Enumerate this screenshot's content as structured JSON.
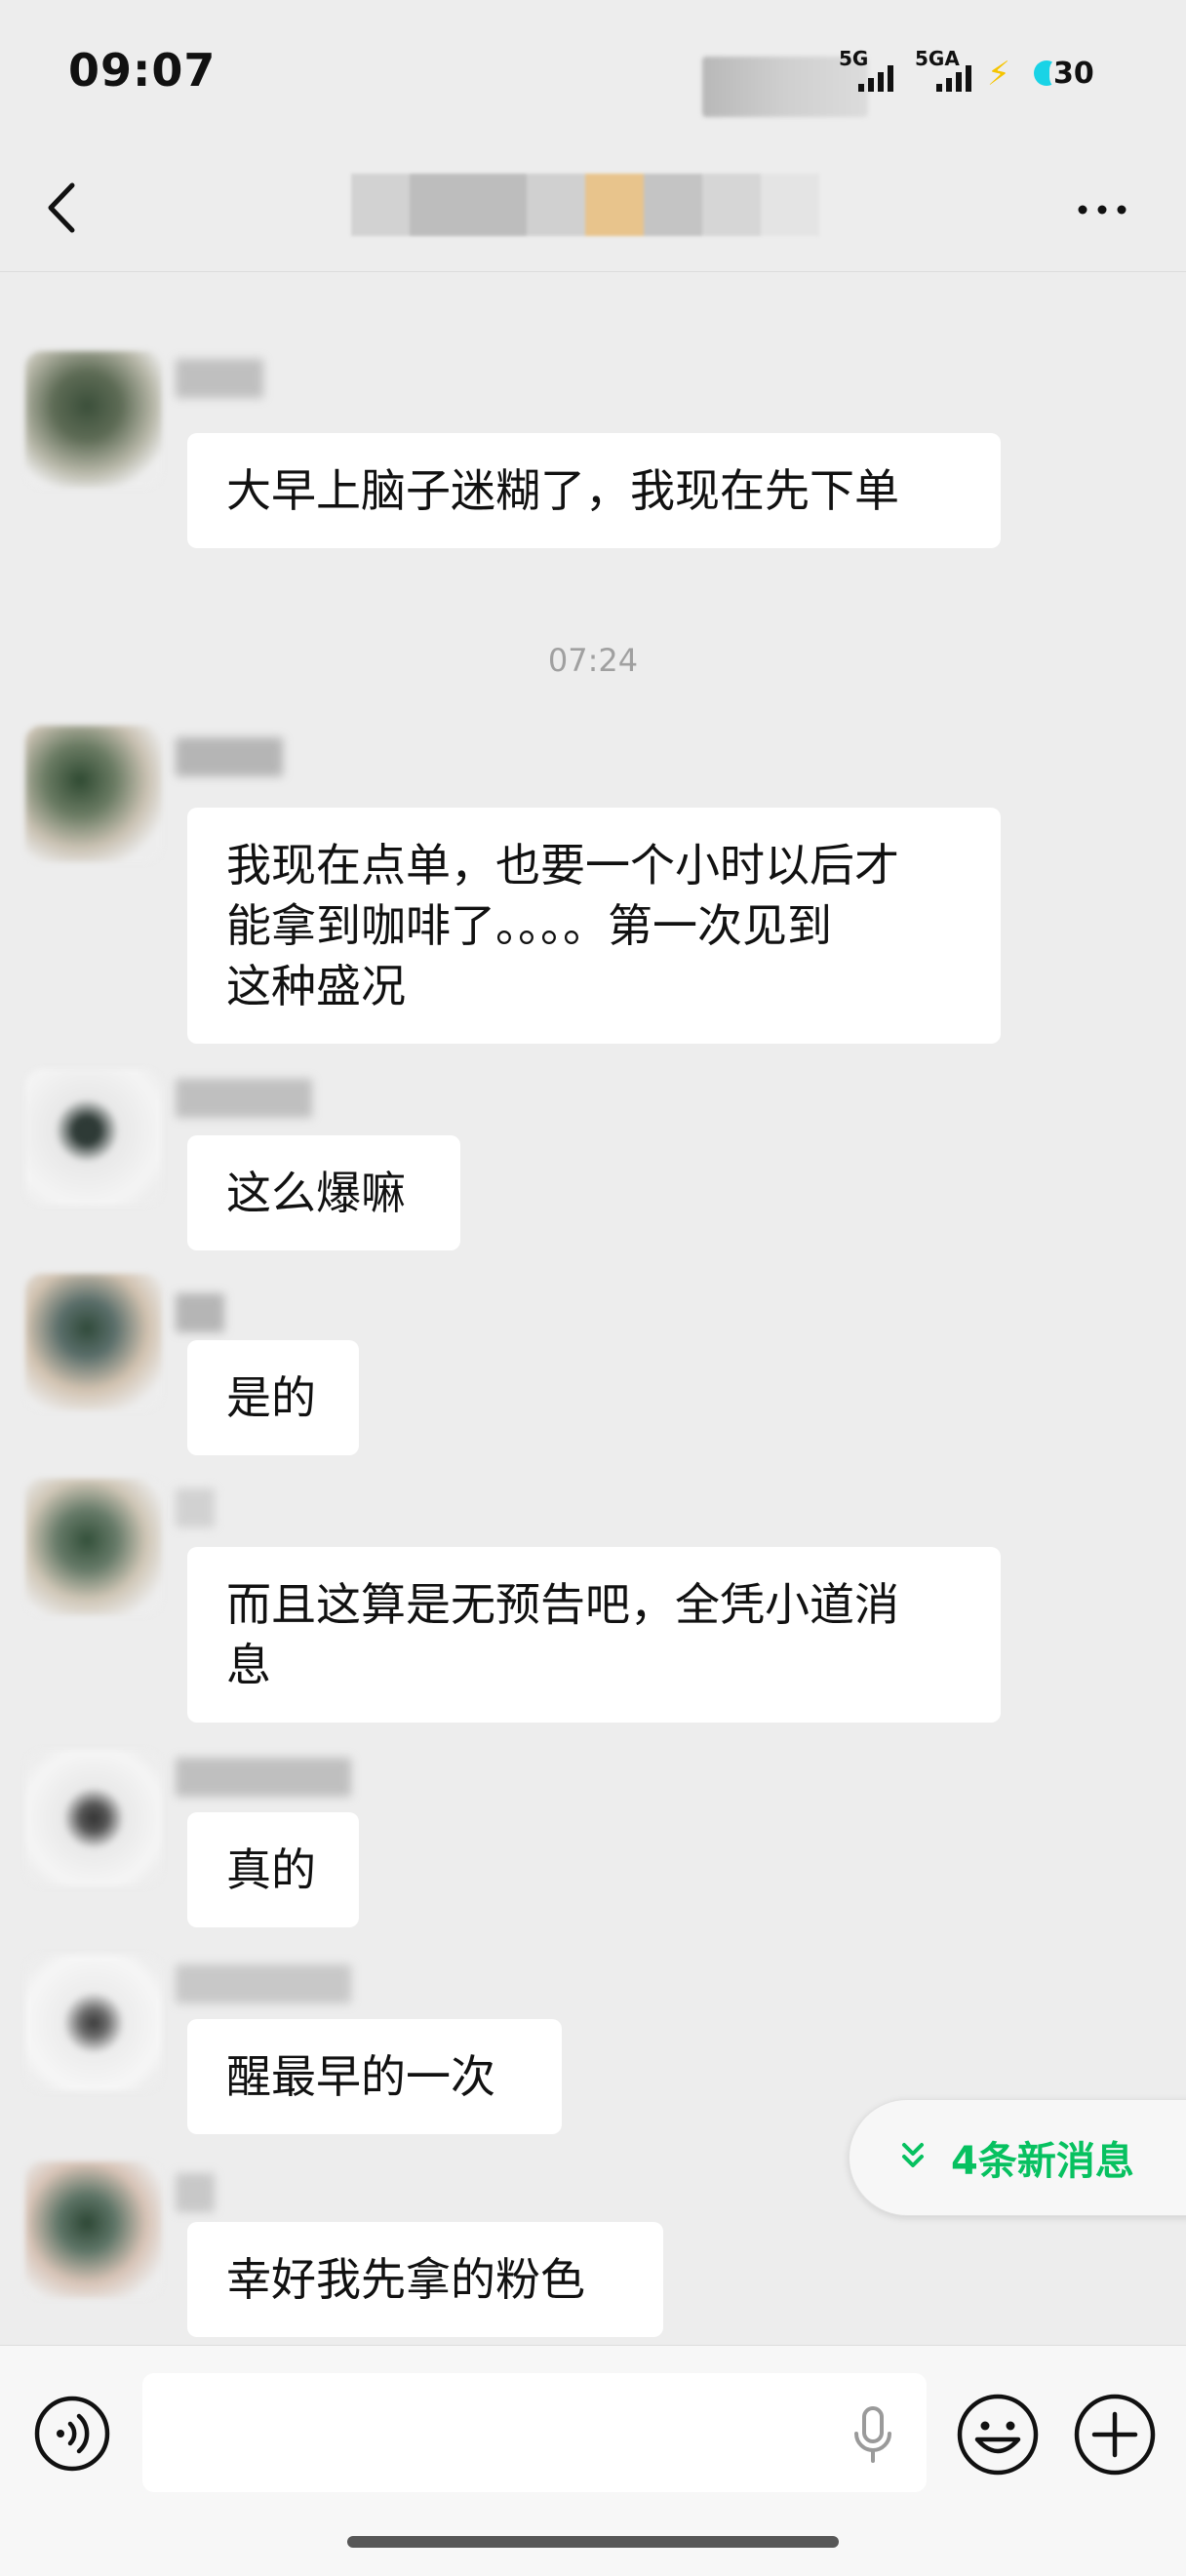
{
  "status": {
    "time": "09:07",
    "net1": "5G",
    "net2": "5GA",
    "battery": "30"
  },
  "nav": {
    "back": "back",
    "more": "more"
  },
  "messages": [
    {
      "text": "大早上脑子迷糊了，我现在先下单"
    },
    {
      "text": "我现在点单，也要一个小时以后才\n能拿到咖啡了。。。。第一次见到\n这种盛况"
    },
    {
      "text": "这么爆嘛"
    },
    {
      "text": "是的"
    },
    {
      "text": "而且这算是无预告吧，全凭小道消\n息"
    },
    {
      "text": "真的"
    },
    {
      "text": "醒最早的一次"
    },
    {
      "text": "幸好我先拿的粉色"
    }
  ],
  "timestamp": "07:24",
  "new_messages_label": "4条新消息",
  "input": {
    "value": "",
    "placeholder": ""
  },
  "colors": {
    "accent": "#07c160",
    "background": "#ededed",
    "bubble": "#ffffff"
  },
  "icons": [
    "back-icon",
    "more-icon",
    "voice-icon",
    "mic-icon",
    "emoji-icon",
    "plus-icon",
    "double-chevron-down-icon"
  ]
}
